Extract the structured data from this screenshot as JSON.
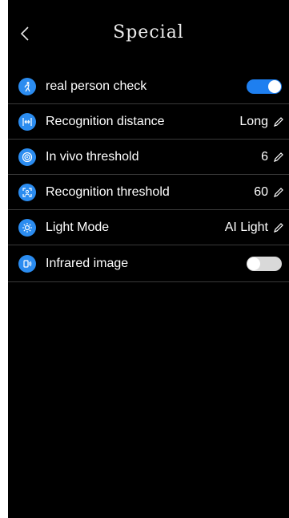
{
  "header": {
    "title": "Special"
  },
  "settings": {
    "rows": [
      {
        "label": "real person check",
        "control": "toggle",
        "enabled": true,
        "icon": "person-walk-icon"
      },
      {
        "label": "Recognition distance",
        "value": "Long",
        "icon": "distance-icon"
      },
      {
        "label": "In vivo threshold",
        "value": "6",
        "icon": "target-icon"
      },
      {
        "label": "Recognition threshold",
        "value": "60",
        "icon": "face-scan-icon"
      },
      {
        "label": "Light Mode",
        "value": "AI Light",
        "icon": "sun-icon"
      },
      {
        "label": "Infrared image",
        "control": "toggle",
        "enabled": false,
        "icon": "infrared-icon"
      }
    ]
  },
  "colors": {
    "accent": "#1e7ff0",
    "background": "#000000",
    "toggle_off": "#d9d9d9"
  }
}
